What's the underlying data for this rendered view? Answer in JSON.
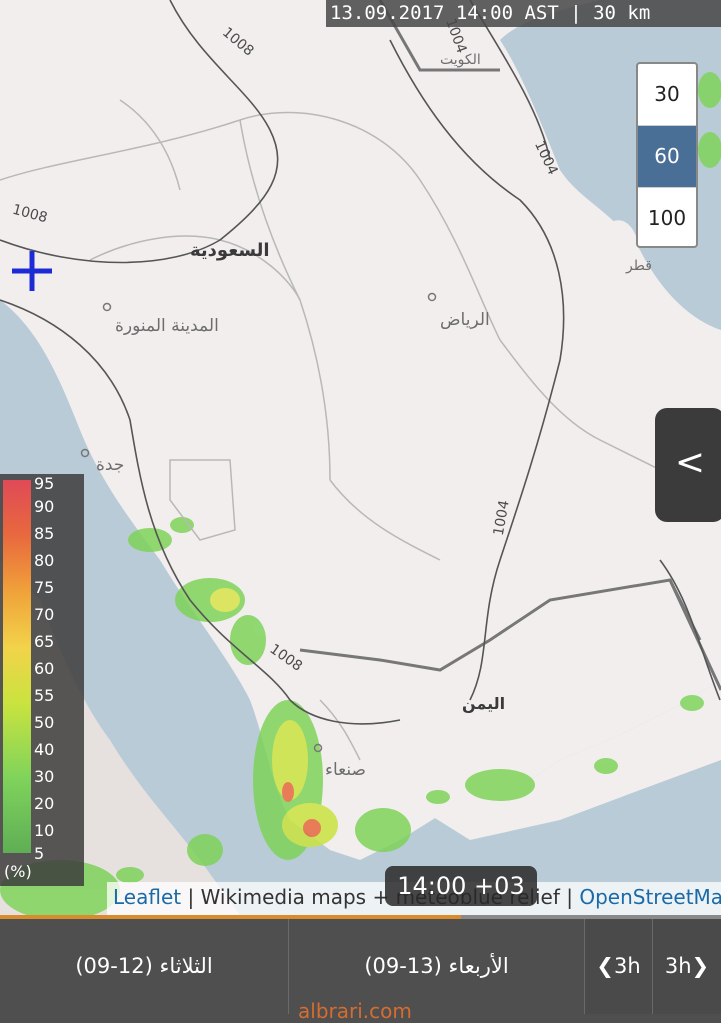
{
  "header": {
    "datetime": "13.09.2017 14:00 AST | 30 km"
  },
  "resolution": {
    "options": [
      "30",
      "60",
      "100"
    ],
    "selected": "60"
  },
  "side_toggle": {
    "label": "<"
  },
  "map": {
    "places": {
      "saudi": "السعودية",
      "medina": "المدينة المنورة",
      "riyadh": "الرياض",
      "jeddah": "جدة",
      "yemen": "اليمن",
      "sanaa": "صنعاء",
      "kuwait": "الكويت",
      "qatar": "قطر"
    },
    "isobars": [
      "1008",
      "1008",
      "1004",
      "1004",
      "1008",
      "1004"
    ]
  },
  "legend": {
    "values": [
      "95",
      "90",
      "85",
      "80",
      "75",
      "70",
      "65",
      "60",
      "55",
      "50",
      "40",
      "30",
      "20",
      "10",
      "5"
    ],
    "unit": "(%)"
  },
  "attribution": {
    "leaflet": "Leaflet",
    "wikimedia": " | Wikimedia maps + meteoblue relief | ",
    "osm": "OpenStreetMap"
  },
  "time_label": "14:00 +03",
  "progress": {
    "value": 0.64
  },
  "timeline": {
    "day1": "(الثلاثاء (12-09",
    "day2": "(الأربعاء (13-09",
    "step_back": "❮3h",
    "step_fwd": "3h❯"
  },
  "watermark": "albrari.com"
}
